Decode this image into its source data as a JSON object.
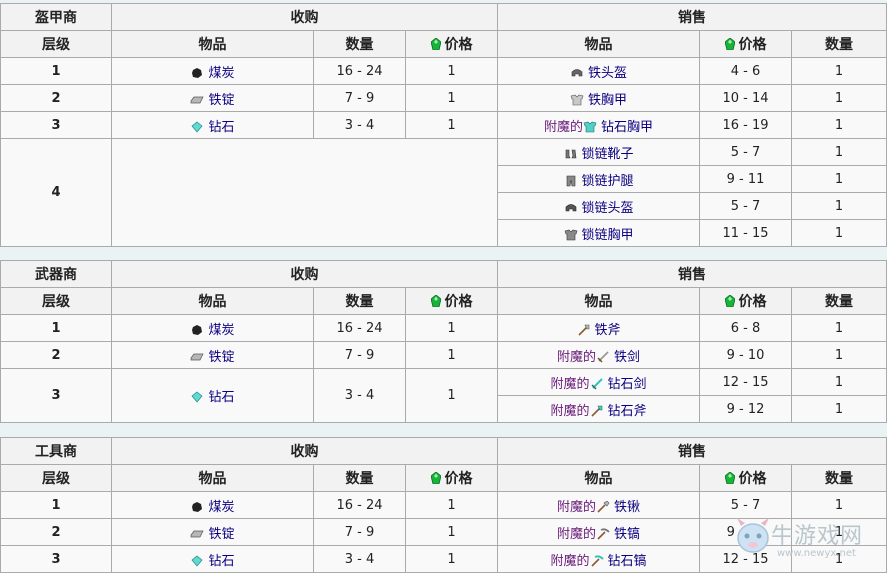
{
  "headers": {
    "level": "层级",
    "buy": "收购",
    "sell": "销售",
    "item": "物品",
    "quantity": "数量",
    "price": "价格"
  },
  "enchant_prefix": "附魔的",
  "armorer": {
    "title": "盔甲商",
    "rows": [
      {
        "level": "1",
        "buy": {
          "item": "煤炭",
          "qty": "16 - 24",
          "price": "1"
        },
        "sell": [
          {
            "item": "铁头盔",
            "icon": "helmet-icon",
            "price": "4 - 6",
            "qty": "1",
            "enchanted": false
          }
        ]
      },
      {
        "level": "2",
        "buy": {
          "item": "铁锭",
          "qty": "7 - 9",
          "price": "1"
        },
        "sell": [
          {
            "item": "铁胸甲",
            "icon": "chestplate-icon",
            "price": "10 - 14",
            "qty": "1",
            "enchanted": false
          }
        ]
      },
      {
        "level": "3",
        "buy": {
          "item": "钻石",
          "qty": "3 - 4",
          "price": "1"
        },
        "sell": [
          {
            "item": "钻石胸甲",
            "icon": "diamond-chestplate-icon",
            "price": "16 - 19",
            "qty": "1",
            "enchanted": true
          }
        ]
      },
      {
        "level": "4",
        "buy": null,
        "sell": [
          {
            "item": "锁链靴子",
            "icon": "boots-icon",
            "price": "5 - 7",
            "qty": "1",
            "enchanted": false
          },
          {
            "item": "锁链护腿",
            "icon": "leggings-icon",
            "price": "9 - 11",
            "qty": "1",
            "enchanted": false
          },
          {
            "item": "锁链头盔",
            "icon": "helmet-icon",
            "price": "5 - 7",
            "qty": "1",
            "enchanted": false
          },
          {
            "item": "锁链胸甲",
            "icon": "chestplate-icon",
            "price": "11 - 15",
            "qty": "1",
            "enchanted": false
          }
        ]
      }
    ]
  },
  "weaponsmith": {
    "title": "武器商",
    "rows": [
      {
        "level": "1",
        "buy": {
          "item": "煤炭",
          "qty": "16 - 24",
          "price": "1"
        },
        "sell": [
          {
            "item": "铁斧",
            "icon": "axe-icon",
            "price": "6 - 8",
            "qty": "1",
            "enchanted": false
          }
        ]
      },
      {
        "level": "2",
        "buy": {
          "item": "铁锭",
          "qty": "7 - 9",
          "price": "1"
        },
        "sell": [
          {
            "item": "铁剑",
            "icon": "sword-icon",
            "price": "9 - 10",
            "qty": "1",
            "enchanted": true
          }
        ]
      },
      {
        "level": "3",
        "buy": {
          "item": "钻石",
          "qty": "3 - 4",
          "price": "1"
        },
        "sell": [
          {
            "item": "钻石剑",
            "icon": "diamond-sword-icon",
            "price": "12 - 15",
            "qty": "1",
            "enchanted": true
          },
          {
            "item": "钻石斧",
            "icon": "diamond-axe-icon",
            "price": "9 - 12",
            "qty": "1",
            "enchanted": true
          }
        ]
      }
    ]
  },
  "toolsmith": {
    "title": "工具商",
    "rows": [
      {
        "level": "1",
        "buy": {
          "item": "煤炭",
          "qty": "16 - 24",
          "price": "1"
        },
        "sell": [
          {
            "item": "铁锹",
            "icon": "shovel-icon",
            "price": "5 - 7",
            "qty": "1",
            "enchanted": true
          }
        ]
      },
      {
        "level": "2",
        "buy": {
          "item": "铁锭",
          "qty": "7 - 9",
          "price": "1"
        },
        "sell": [
          {
            "item": "铁镐",
            "icon": "pickaxe-icon",
            "price": "9 - 10",
            "qty": "1",
            "enchanted": true
          }
        ]
      },
      {
        "level": "3",
        "buy": {
          "item": "钻石",
          "qty": "3 - 4",
          "price": "1"
        },
        "sell": [
          {
            "item": "钻石镐",
            "icon": "diamond-pickaxe-icon",
            "price": "12 - 15",
            "qty": "1",
            "enchanted": true
          }
        ]
      }
    ]
  },
  "watermark": {
    "text": "牛游戏网",
    "url": "www.newyx.net"
  }
}
